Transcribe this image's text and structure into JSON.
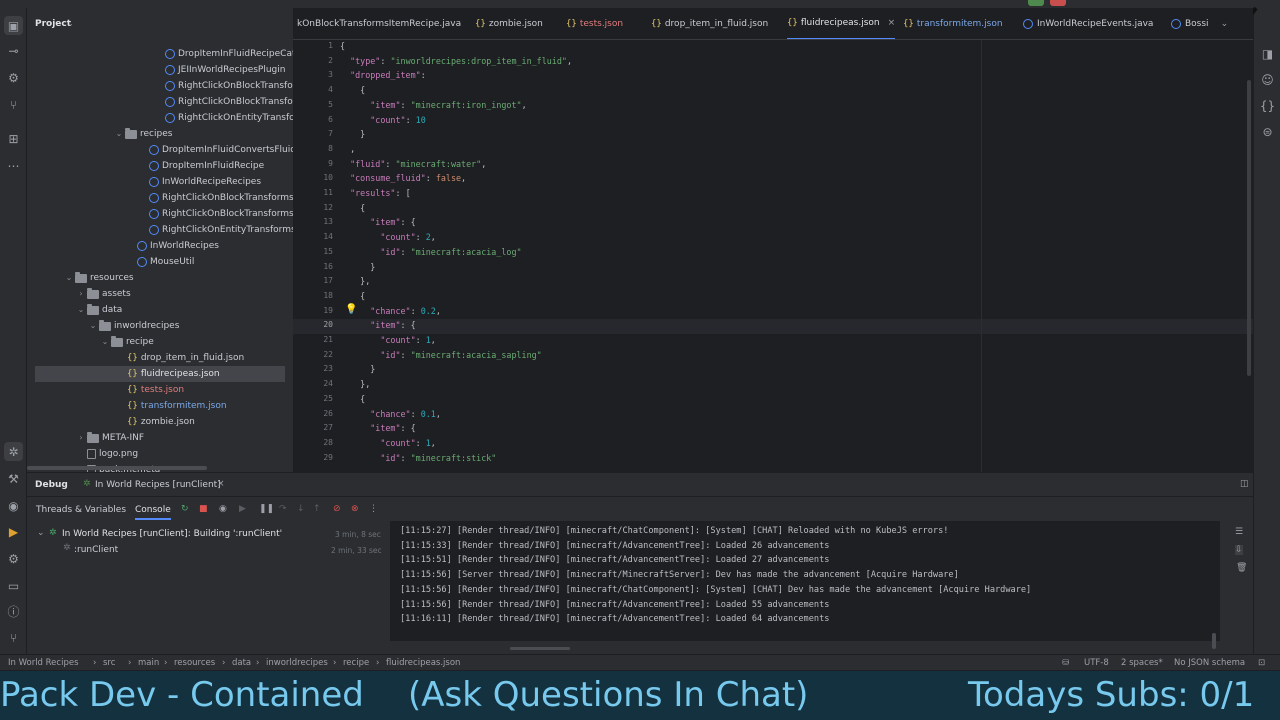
{
  "colors": {
    "accent": "#548af7",
    "string": "#6aab73",
    "number": "#2aacb8",
    "key": "#c77dbb",
    "banner_text": "#78c9ee",
    "banner_bg": "#13313e"
  },
  "project": {
    "title": "Project"
  },
  "tree": [
    {
      "label": "DropItemInFluidRecipeCateg",
      "icon": "class-icon"
    },
    {
      "label": "JEIInWorldRecipesPlugin",
      "icon": "class-icon"
    },
    {
      "label": "RightClickOnBlockTransform",
      "icon": "class-icon"
    },
    {
      "label": "RightClickOnBlockTransform",
      "icon": "class-icon"
    },
    {
      "label": "RightClickOnEntityTransform",
      "icon": "class-icon"
    },
    {
      "label": "recipes",
      "icon": "folder-icon"
    },
    {
      "label": "DropItemInFluidConvertsFluidRe",
      "icon": "class-icon"
    },
    {
      "label": "DropItemInFluidRecipe",
      "icon": "class-icon"
    },
    {
      "label": "InWorldRecipeRecipes",
      "icon": "class-icon"
    },
    {
      "label": "RightClickOnBlockTransformsBl",
      "icon": "class-icon"
    },
    {
      "label": "RightClickOnBlockTransformsIte",
      "icon": "class-icon"
    },
    {
      "label": "RightClickOnEntityTransformsIt",
      "icon": "class-icon"
    },
    {
      "label": "InWorldRecipes",
      "icon": "class-icon"
    },
    {
      "label": "MouseUtil",
      "icon": "class-icon"
    },
    {
      "label": "resources",
      "icon": "folder-icon"
    },
    {
      "label": "assets",
      "icon": "folder-icon"
    },
    {
      "label": "data",
      "icon": "folder-icon"
    },
    {
      "label": "inworldrecipes",
      "icon": "folder-icon"
    },
    {
      "label": "recipe",
      "icon": "folder-icon"
    },
    {
      "label": "drop_item_in_fluid.json",
      "icon": "json-icon"
    },
    {
      "label": "fluidrecipeas.json",
      "icon": "json-icon"
    },
    {
      "label": "tests.json",
      "icon": "json-icon"
    },
    {
      "label": "transformitem.json",
      "icon": "json-icon"
    },
    {
      "label": "zombie.json",
      "icon": "json-icon"
    },
    {
      "label": "META-INF",
      "icon": "folder-icon"
    },
    {
      "label": "logo.png",
      "icon": "image-icon"
    },
    {
      "label": "pack.mcmeta",
      "icon": "file-icon"
    }
  ],
  "tabs": [
    {
      "label": "kOnBlockTransformsItemRecipe.java"
    },
    {
      "label": "zombie.json"
    },
    {
      "label": "tests.json"
    },
    {
      "label": "drop_item_in_fluid.json"
    },
    {
      "label": "fluidrecipeas.json"
    },
    {
      "label": "transformitem.json"
    },
    {
      "label": "InWorldRecipeEvents.java"
    },
    {
      "label": "Bossi"
    }
  ],
  "editor": {
    "line_numbers": [
      "1",
      "2",
      "3",
      "4",
      "5",
      "6",
      "7",
      "8",
      "9",
      "10",
      "11",
      "12",
      "13",
      "14",
      "15",
      "16",
      "17",
      "18",
      "19",
      "20",
      "21",
      "22",
      "23",
      "24",
      "25",
      "26",
      "27",
      "28",
      "29"
    ],
    "lines": [
      "{",
      "  \"type\": \"inworldrecipes:drop_item_in_fluid\",",
      "  \"dropped_item\":",
      "    {",
      "      \"item\": \"minecraft:iron_ingot\",",
      "      \"count\": 10",
      "    }",
      "  ,",
      "  \"fluid\": \"minecraft:water\",",
      "  \"consume_fluid\": false,",
      "  \"results\": [",
      "    {",
      "      \"item\": {",
      "        \"count\": 2,",
      "        \"id\": \"minecraft:acacia_log\"",
      "      }",
      "    },",
      "    {",
      "      \"chance\": 0.2,",
      "      \"item\": {",
      "        \"count\": 1,",
      "        \"id\": \"minecraft:acacia_sapling\"",
      "      }",
      "    },",
      "    {",
      "      \"chance\": 0.1,",
      "      \"item\": {",
      "        \"count\": 1,",
      "        \"id\": \"minecraft:stick\""
    ]
  },
  "debug": {
    "tab": "Debug",
    "run_config": "In World Recipes [runClient]",
    "subtab_threads": "Threads & Variables",
    "subtab_console": "Console",
    "session_label": "In World Recipes [runClient]: Building ':runClient'",
    "session_time": "3 min, 8 sec",
    "task_label": ":runClient",
    "task_time": "2 min, 33 sec"
  },
  "console_lines": [
    "[11:15:27] [Render thread/INFO] [minecraft/ChatComponent]: [System] [CHAT] Reloaded with no KubeJS errors!",
    "[11:15:33] [Render thread/INFO] [minecraft/AdvancementTree]: Loaded 26 advancements",
    "[11:15:51] [Render thread/INFO] [minecraft/AdvancementTree]: Loaded 27 advancements",
    "[11:15:56] [Server thread/INFO] [minecraft/MinecraftServer]: Dev has made the advancement [Acquire Hardware]",
    "[11:15:56] [Render thread/INFO] [minecraft/ChatComponent]: [System] [CHAT] Dev has made the advancement [Acquire Hardware]",
    "[11:15:56] [Render thread/INFO] [minecraft/AdvancementTree]: Loaded 55 advancements",
    "[11:16:11] [Render thread/INFO] [minecraft/AdvancementTree]: Loaded 64 advancements"
  ],
  "breadcrumb": [
    "In World Recipes",
    "src",
    "main",
    "resources",
    "data",
    "inworldrecipes",
    "recipe",
    "fluidrecipeas.json"
  ],
  "status": {
    "encoding": "UTF-8",
    "indent": "2 spaces*",
    "schema": "No JSON schema"
  },
  "banner": {
    "left": "Pack Dev - Contained",
    "middle": "(Ask Questions In Chat)",
    "right": "Todays Subs: 0/1"
  }
}
